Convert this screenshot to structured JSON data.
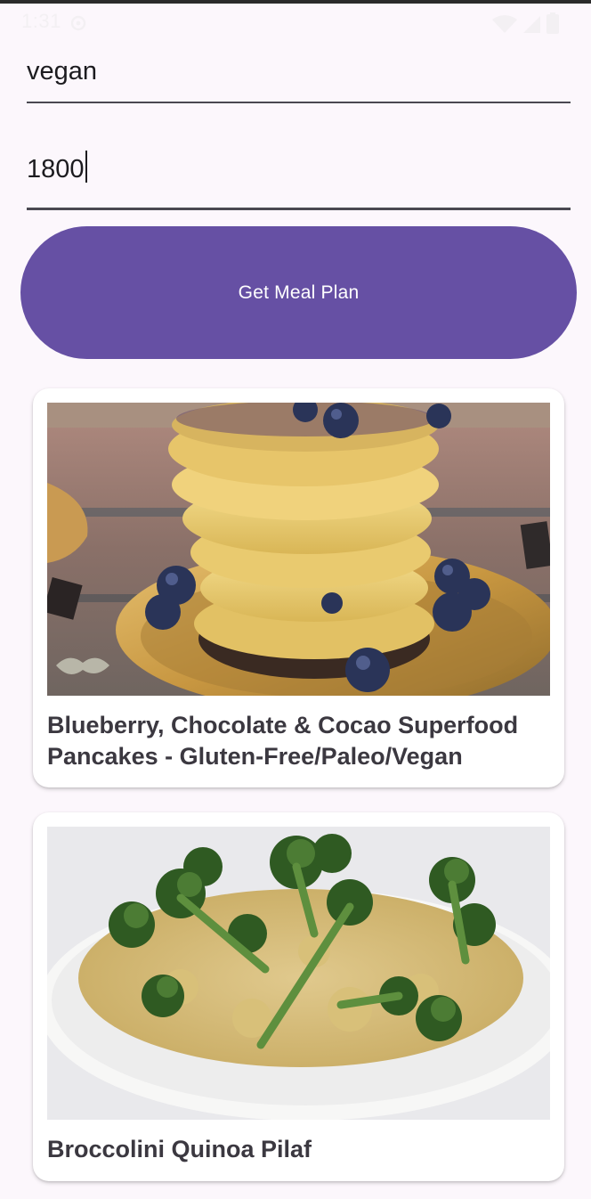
{
  "status_bar": {
    "time": "1:31"
  },
  "form": {
    "diet_value": "vegan",
    "calories_value": "1800",
    "submit_label": "Get Meal Plan"
  },
  "meals": [
    {
      "title": "Blueberry, Chocolate & Cocao Superfood Pancakes - Gluten-Free/Paleo/Vegan",
      "image": "pancake-stack-photo"
    },
    {
      "title": "Broccolini Quinoa Pilaf",
      "image": "quinoa-pilaf-photo"
    }
  ],
  "colors": {
    "background": "#fcf7fc",
    "primary": "#6650a4",
    "card": "#ffffff",
    "title_text": "#3b3840"
  }
}
